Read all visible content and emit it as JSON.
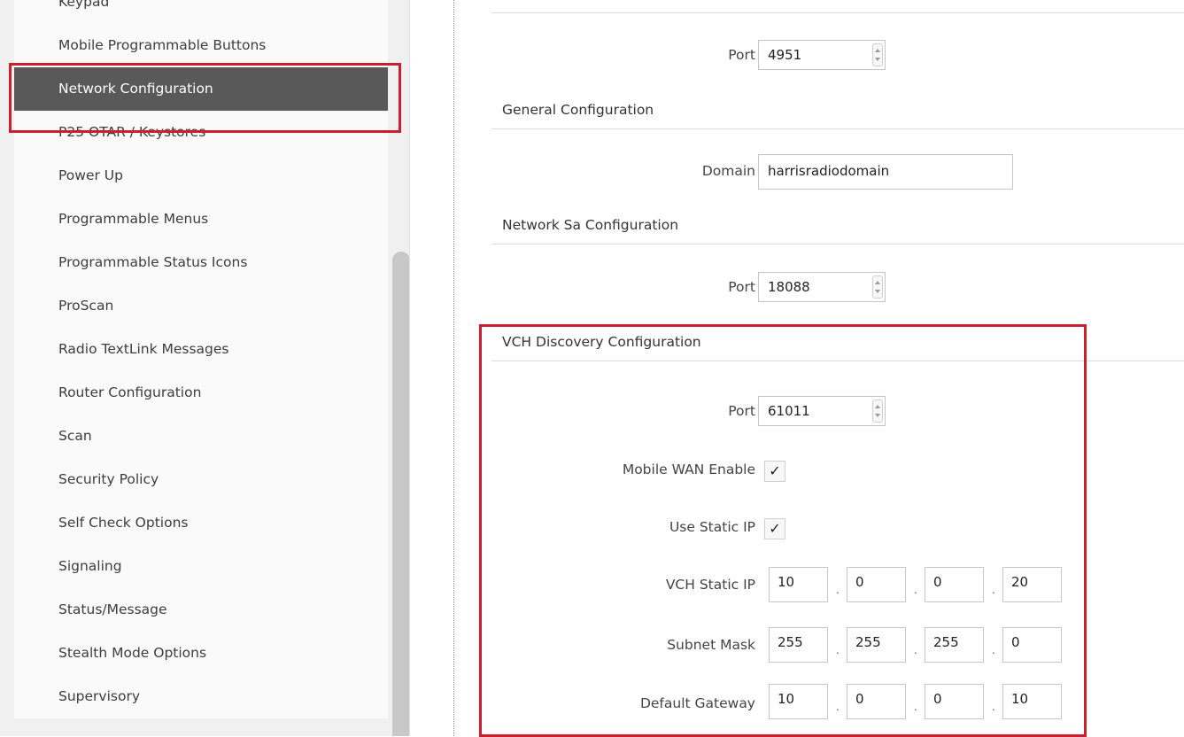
{
  "sidebar": {
    "items": [
      {
        "label": "Keypad"
      },
      {
        "label": "Mobile Programmable Buttons"
      },
      {
        "label": "Network Configuration"
      },
      {
        "label": "P25 OTAR / Keystores"
      },
      {
        "label": "Power Up"
      },
      {
        "label": "Programmable Menus"
      },
      {
        "label": "Programmable Status Icons"
      },
      {
        "label": "ProScan"
      },
      {
        "label": "Radio TextLink Messages"
      },
      {
        "label": "Router Configuration"
      },
      {
        "label": "Scan"
      },
      {
        "label": "Security Policy"
      },
      {
        "label": "Self Check Options"
      },
      {
        "label": "Signaling"
      },
      {
        "label": "Status/Message"
      },
      {
        "label": "Stealth Mode Options"
      },
      {
        "label": "Supervisory"
      }
    ],
    "active_index": 2
  },
  "main": {
    "top_port": {
      "label": "Port",
      "value": "4951"
    },
    "general": {
      "title": "General Configuration",
      "domain_label": "Domain",
      "domain_value": "harrisradiodomain"
    },
    "network_sa": {
      "title": "Network Sa Configuration",
      "port_label": "Port",
      "port_value": "18088"
    },
    "vch": {
      "title": "VCH Discovery Configuration",
      "port_label": "Port",
      "port_value": "61011",
      "mobile_wan_label": "Mobile WAN Enable",
      "mobile_wan_checked": true,
      "use_static_ip_label": "Use Static IP",
      "use_static_ip_checked": true,
      "static_ip_label": "VCH Static IP",
      "static_ip": [
        "10",
        "0",
        "0",
        "20"
      ],
      "subnet_label": "Subnet Mask",
      "subnet": [
        "255",
        "255",
        "255",
        "0"
      ],
      "gateway_label": "Default Gateway",
      "gateway": [
        "10",
        "0",
        "0",
        "10"
      ]
    },
    "check_glyph": "✓",
    "octet_separator": "."
  },
  "colors": {
    "active_item_bg": "#595959",
    "highlight_border": "#c8202f"
  }
}
